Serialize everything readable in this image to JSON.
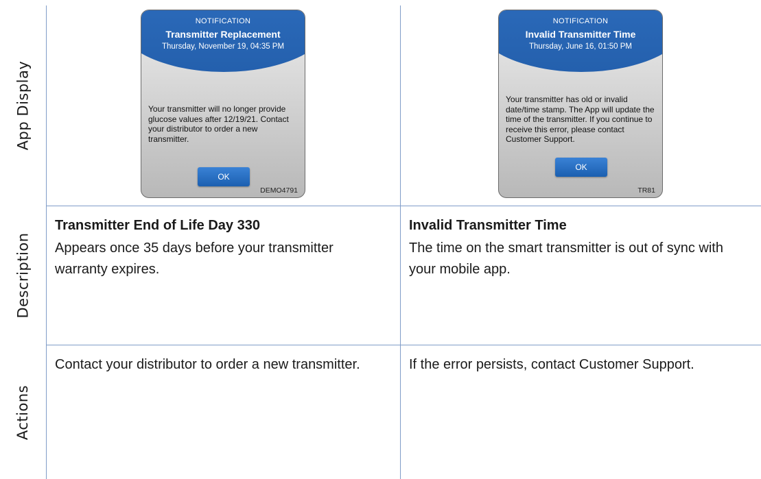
{
  "row_labels": {
    "app_display": "App Display",
    "description": "Description",
    "actions": "Actions"
  },
  "left": {
    "notification": {
      "kind": "NOTIFICATION",
      "title": "Transmitter Replacement",
      "date": "Thursday, November 19, 04:35 PM",
      "body": "Your transmitter will no longer provide glucose values after 12/19/21. Contact your distributor to order a new transmitter.",
      "ok_label": "OK",
      "code": "DEMO4791"
    },
    "description_title": "Transmitter End of Life Day 330",
    "description_text": "Appears once 35 days before your transmitter warranty expires.",
    "actions_text": "Contact your distributor to order a new transmitter."
  },
  "right": {
    "notification": {
      "kind": "NOTIFICATION",
      "title": "Invalid Transmitter Time",
      "date": "Thursday, June 16, 01:50 PM",
      "body": "Your transmitter has old or invalid date/time stamp. The App will update the time of the transmitter. If you continue to receive this error, please contact Customer Support.",
      "ok_label": "OK",
      "code": "TR81"
    },
    "description_title": "Invalid Transmitter Time",
    "description_text": "The time on the smart transmitter is out of sync with your mobile app.",
    "actions_text": "If the error persists, contact Customer Support."
  }
}
